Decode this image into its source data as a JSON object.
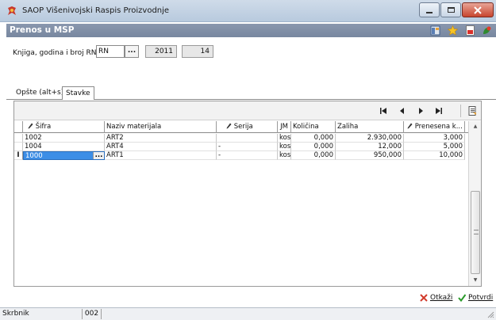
{
  "window": {
    "app_title": "SAOP  Višenivojski Raspis Proizvodnje",
    "section_title": "Prenos u MSP"
  },
  "form": {
    "label": "Knjiga, godina i broj RN",
    "book": "RN",
    "lookup": "...",
    "year": "2011",
    "number": "14"
  },
  "tabs": [
    {
      "label": "Opšte (alt+s)",
      "active": false
    },
    {
      "label": "Stavke",
      "active": true
    }
  ],
  "grid": {
    "columns": [
      "Šifra",
      "Naziv materijala",
      "Serija",
      "JM",
      "Količina",
      "Zaliha",
      "Prenesena k..."
    ],
    "rows": [
      {
        "sifra": "1002",
        "naziv": "ART2",
        "serija": "",
        "jm": "kos",
        "kolicina": "0,000",
        "zaliha": "2.930,000",
        "prenesena": "3,000"
      },
      {
        "sifra": "1004",
        "naziv": "ART4",
        "serija": "-",
        "jm": "kos",
        "kolicina": "0,000",
        "zaliha": "12,000",
        "prenesena": "5,000"
      },
      {
        "sifra": "1000",
        "naziv": "ART1",
        "serija": "-",
        "jm": "kos",
        "kolicina": "0,000",
        "zaliha": "950,000",
        "prenesena": "10,000"
      }
    ],
    "row_marker": "I",
    "cell_button": "..."
  },
  "footer": {
    "cancel": "Otkaži",
    "confirm": "Potvrdi"
  },
  "status": {
    "label": "Skrbnik",
    "value": "002"
  },
  "colors": {
    "title_bar": "#c3d3e6",
    "section_header": "#808fa6",
    "selection": "#3d8ee6",
    "cancel_icon": "#d23b2c",
    "confirm_icon": "#2a9a2a"
  },
  "icons": [
    "app-logo-icon",
    "minimize-icon",
    "maximize-icon",
    "close-icon",
    "layout-icon",
    "favorite-star-icon",
    "pdf-icon",
    "help-icon",
    "first-record-icon",
    "previous-record-icon",
    "next-record-icon",
    "last-record-icon",
    "export-icon",
    "pencil-icon",
    "cancel-x-icon",
    "confirm-check-icon",
    "resize-grip-icon"
  ]
}
